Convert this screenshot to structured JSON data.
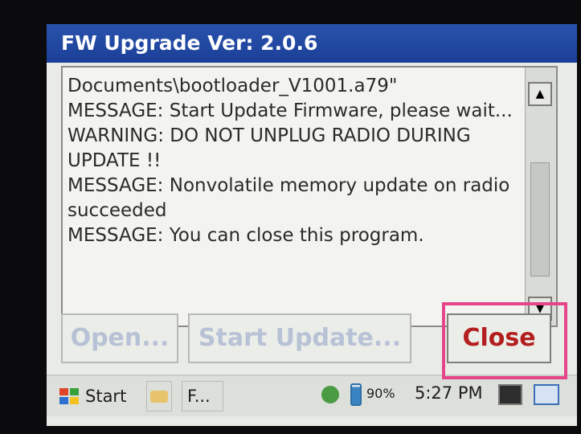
{
  "window": {
    "title": "FW Upgrade Ver: 2.0.6"
  },
  "log": {
    "lines": [
      "Documents\\bootloader_V1001.a79\"",
      "MESSAGE: Start Update Firmware, please wait...",
      "WARNING: DO NOT UNPLUG RADIO DURING",
      "UPDATE !!",
      "MESSAGE: Nonvolatile memory update on radio",
      "succeeded",
      "MESSAGE: You can close this program."
    ]
  },
  "buttons": {
    "open": "Open...",
    "start_update": "Start Update...",
    "close": "Close"
  },
  "taskbar": {
    "start": "Start",
    "task": "F...",
    "battery": "90%",
    "time": "5:27 PM"
  },
  "colors": {
    "title_bar": "#1f46a0",
    "close_text": "#b31e1e",
    "highlight": "#e5468a"
  }
}
